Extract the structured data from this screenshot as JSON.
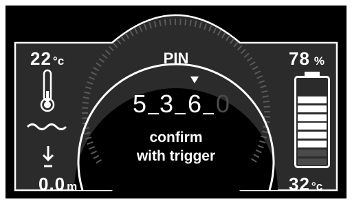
{
  "temperature_left": {
    "value": "22",
    "unit": "°c"
  },
  "depth": {
    "value": "0.0",
    "unit": "m"
  },
  "battery": {
    "value": "78",
    "unit": "%",
    "segments_total": 8,
    "segments_full": 6
  },
  "temperature_right": {
    "value": "32",
    "unit": "°c"
  },
  "pin": {
    "title": "PIN",
    "digits": [
      "5",
      "3",
      "6",
      "0"
    ],
    "active_digits": 3,
    "cursor_index": 2
  },
  "instruction": {
    "line1": "confirm",
    "line2": "with trigger"
  },
  "icons": {
    "thermometer": "thermometer-icon",
    "water": "water-wave-icon",
    "descend": "descend-arrow-icon",
    "battery": "battery-icon",
    "cursor": "triangle-down-icon"
  },
  "colors": {
    "background": "#000000",
    "frame": "#ffffff",
    "panel": "#2b2b2b",
    "text": "#ffffff",
    "battery_empty": "#4a4a4a"
  }
}
